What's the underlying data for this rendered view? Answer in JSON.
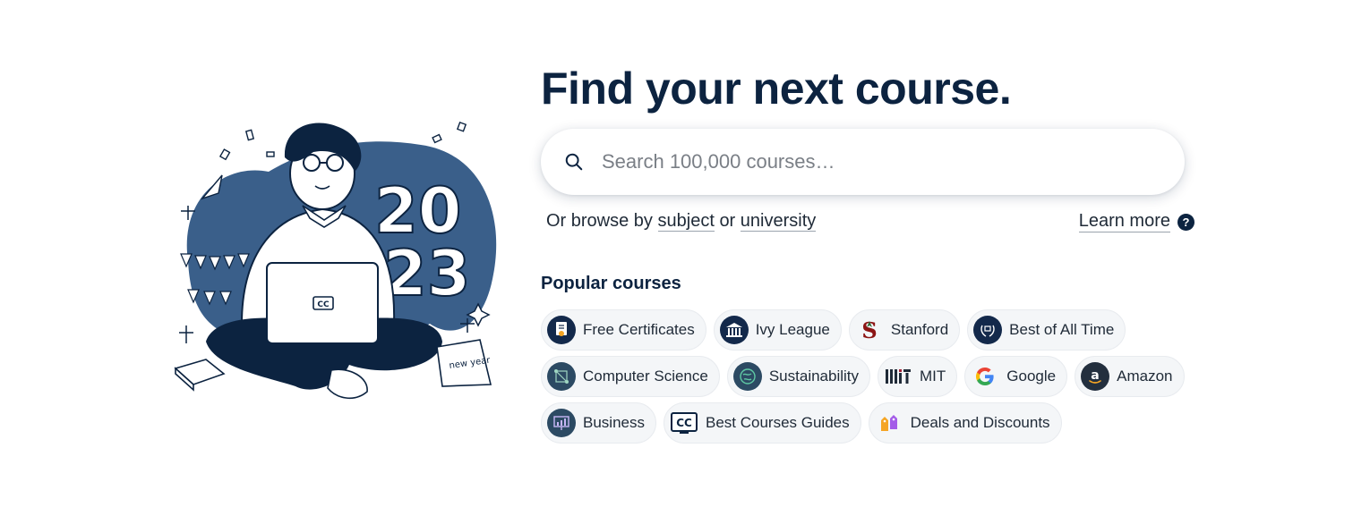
{
  "illustration": {
    "year_top": "20",
    "year_bottom": "23",
    "laptop_badge": "CC",
    "calendar_text": "new year"
  },
  "hero": {
    "headline": "Find your next course.",
    "search_placeholder": "Search 100,000 courses…",
    "browse_prefix": "Or browse by",
    "browse_subject": "subject",
    "browse_or": "or",
    "browse_university": "university",
    "learn_more": "Learn more",
    "help_symbol": "?"
  },
  "popular": {
    "title": "Popular courses",
    "chips": [
      {
        "label": "Free Certificates",
        "icon": "certificate-icon"
      },
      {
        "label": "Ivy League",
        "icon": "building-icon"
      },
      {
        "label": "Stanford",
        "icon": "stanford-logo-icon"
      },
      {
        "label": "Best of All Time",
        "icon": "laurel-icon"
      },
      {
        "label": "Computer Science",
        "icon": "circuit-icon"
      },
      {
        "label": "Sustainability",
        "icon": "globe-icon"
      },
      {
        "label": "MIT",
        "icon": "mit-logo-icon"
      },
      {
        "label": "Google",
        "icon": "google-logo-icon"
      },
      {
        "label": "Amazon",
        "icon": "amazon-logo-icon"
      },
      {
        "label": "Business",
        "icon": "chart-board-icon"
      },
      {
        "label": "Best Courses Guides",
        "icon": "cc-logo-icon"
      },
      {
        "label": "Deals and Discounts",
        "icon": "price-tags-icon"
      }
    ]
  },
  "colors": {
    "navy": "#0c2340",
    "blob": "#3a5f8a",
    "chip_bg": "#f4f6f8",
    "google_blue": "#4285F4",
    "google_red": "#EA4335",
    "google_yellow": "#FBBC05",
    "google_green": "#34A853",
    "deal_orange": "#f5a524",
    "deal_purple": "#a45de8"
  }
}
